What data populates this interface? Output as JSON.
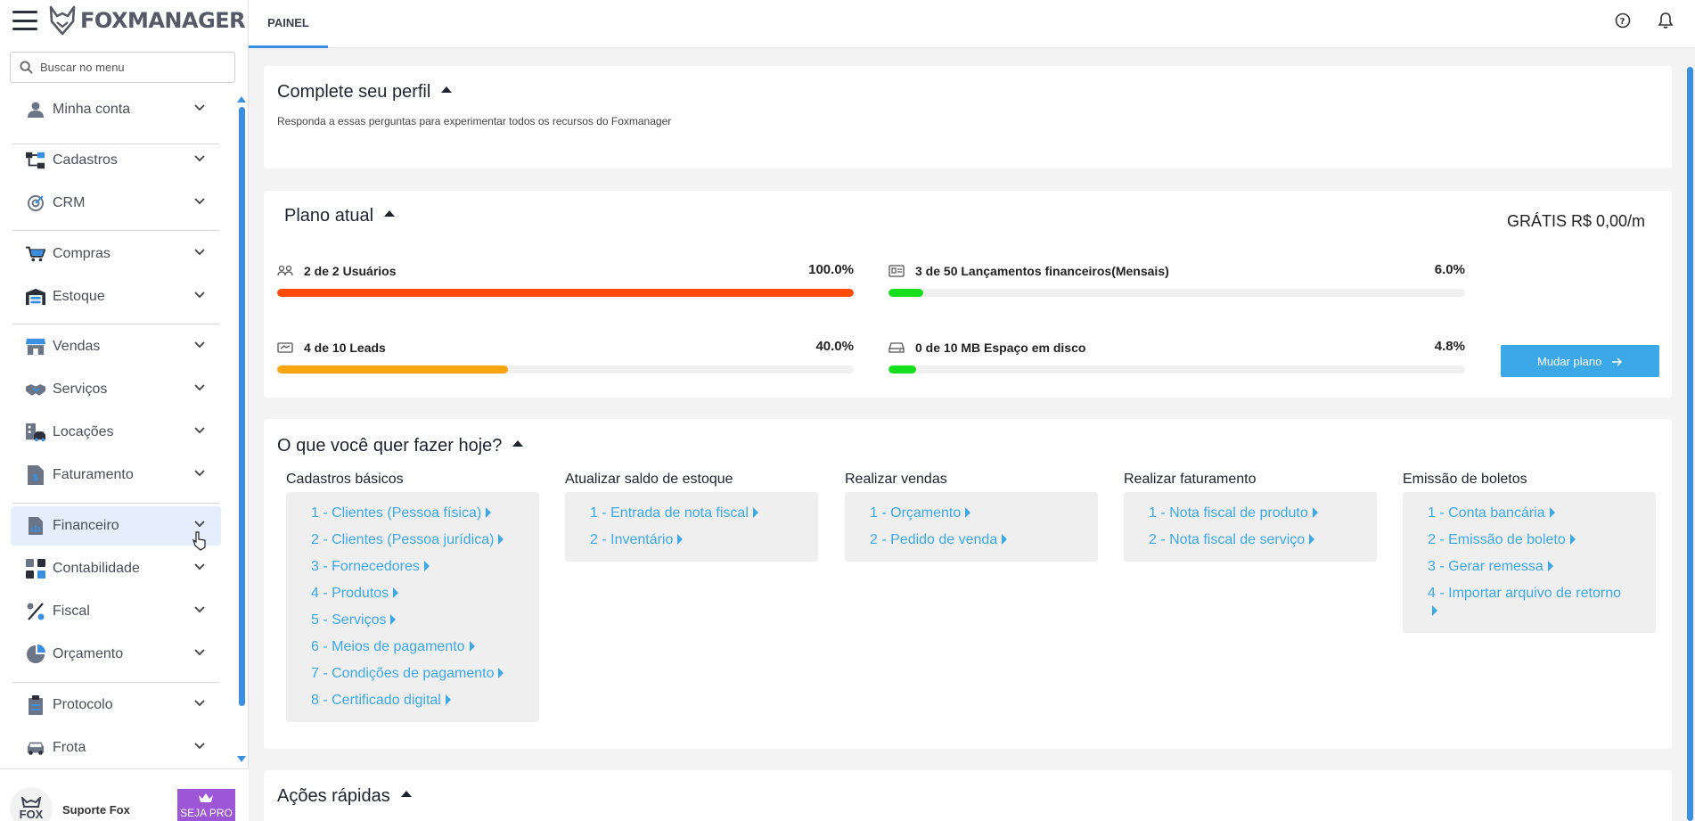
{
  "app": {
    "brand": "FOXMANAGER"
  },
  "sidebar": {
    "search_placeholder": "Buscar no menu",
    "items": [
      {
        "label": "Minha conta",
        "icon": "user-icon"
      },
      {
        "label": "Cadastros",
        "icon": "sitemap-icon"
      },
      {
        "label": "CRM",
        "icon": "target-icon"
      },
      {
        "label": "Compras",
        "icon": "cart-icon"
      },
      {
        "label": "Estoque",
        "icon": "warehouse-icon"
      },
      {
        "label": "Vendas",
        "icon": "store-icon"
      },
      {
        "label": "Serviços",
        "icon": "handshake-icon"
      },
      {
        "label": "Locações",
        "icon": "building-car-icon"
      },
      {
        "label": "Faturamento",
        "icon": "invoice-icon"
      },
      {
        "label": "Financeiro",
        "icon": "report-icon"
      },
      {
        "label": "Contabilidade",
        "icon": "calculator-icon"
      },
      {
        "label": "Fiscal",
        "icon": "percent-icon"
      },
      {
        "label": "Orçamento",
        "icon": "pie-chart-icon"
      },
      {
        "label": "Protocolo",
        "icon": "clipboard-icon"
      },
      {
        "label": "Frota",
        "icon": "car-icon"
      }
    ],
    "footer": {
      "avatar_text": "FOX",
      "support_label": "Suporte Fox",
      "pro_label": "SEJA PRO"
    }
  },
  "topbar": {
    "tab": "PAINEL"
  },
  "profile": {
    "title": "Complete seu perfil",
    "subtitle": "Responda a essas perguntas para experimentar todos os recursos do Foxmanager"
  },
  "plan": {
    "title": "Plano atual",
    "price": "GRÁTIS R$ 0,00/m",
    "button": "Mudar plano",
    "usages": [
      {
        "label": "2 de 2 Usuários",
        "pct_label": "100.0%",
        "pct": 100.0,
        "color": "#ff4b0a"
      },
      {
        "label": "3 de 50 Lançamentos financeiros(Mensais)",
        "pct_label": "6.0%",
        "pct": 6.0,
        "color": "#16e01e"
      },
      {
        "label": "4 de 10 Leads",
        "pct_label": "40.0%",
        "pct": 40.0,
        "color": "#fba512"
      },
      {
        "label": "0 de 10 MB Espaço em disco",
        "pct_label": "4.8%",
        "pct": 4.8,
        "color": "#16e01e"
      }
    ]
  },
  "today": {
    "title": "O que você quer fazer hoje?",
    "columns": [
      {
        "title": "Cadastros básicos",
        "links": [
          "1 - Clientes (Pessoa física)",
          "2 - Clientes (Pessoa jurídica)",
          "3 - Fornecedores",
          "4 - Produtos",
          "5 - Serviços",
          "6 - Meios de pagamento",
          "7 - Condições de pagamento",
          "8 - Certificado digital"
        ]
      },
      {
        "title": "Atualizar saldo de estoque",
        "links": [
          "1 - Entrada de nota fiscal",
          "2 - Inventário"
        ]
      },
      {
        "title": "Realizar vendas",
        "links": [
          "1 - Orçamento",
          "2 - Pedido de venda"
        ]
      },
      {
        "title": "Realizar faturamento",
        "links": [
          "1 - Nota fiscal de produto",
          "2 - Nota fiscal de serviço"
        ]
      },
      {
        "title": "Emissão de boletos",
        "links": [
          "1 - Conta bancária",
          "2 - Emissão de boleto",
          "3 - Gerar remessa",
          "4 - Importar arquivo de retorno"
        ]
      }
    ]
  },
  "quick": {
    "title": "Ações rápidas"
  },
  "colors": {
    "accent": "#3b8fe0",
    "link": "#3da8e8",
    "pro": "#9c56d6"
  }
}
